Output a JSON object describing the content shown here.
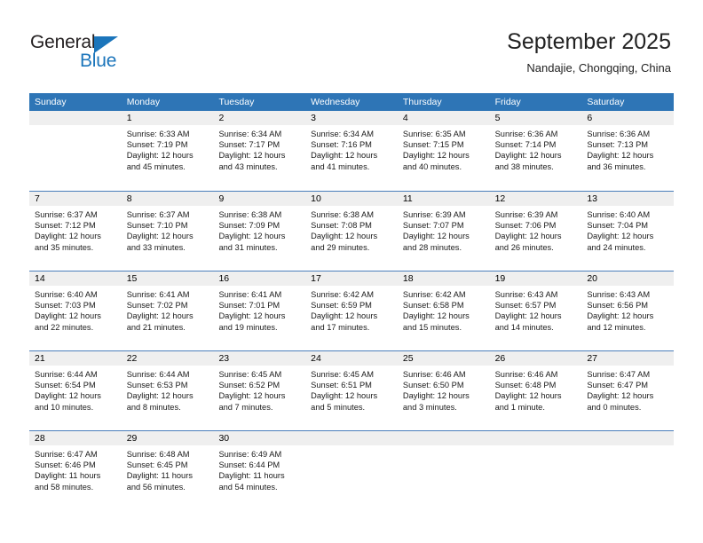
{
  "logo": {
    "word_one": "General",
    "word_two": "Blue",
    "triangle_color": "#1b75bb",
    "text_color": "#231f20"
  },
  "header": {
    "title": "September 2025",
    "subtitle": "Nandajie, Chongqing, China"
  },
  "theme": {
    "header_blue": "#2e75b6",
    "grid_line": "#4a7ebb",
    "day_band": "#efefef"
  },
  "weekdays": [
    "Sunday",
    "Monday",
    "Tuesday",
    "Wednesday",
    "Thursday",
    "Friday",
    "Saturday"
  ],
  "weeks": [
    [
      {
        "day": "",
        "sunrise": "",
        "sunset": "",
        "daylight1": "",
        "daylight2": ""
      },
      {
        "day": "1",
        "sunrise": "Sunrise: 6:33 AM",
        "sunset": "Sunset: 7:19 PM",
        "daylight1": "Daylight: 12 hours",
        "daylight2": "and 45 minutes."
      },
      {
        "day": "2",
        "sunrise": "Sunrise: 6:34 AM",
        "sunset": "Sunset: 7:17 PM",
        "daylight1": "Daylight: 12 hours",
        "daylight2": "and 43 minutes."
      },
      {
        "day": "3",
        "sunrise": "Sunrise: 6:34 AM",
        "sunset": "Sunset: 7:16 PM",
        "daylight1": "Daylight: 12 hours",
        "daylight2": "and 41 minutes."
      },
      {
        "day": "4",
        "sunrise": "Sunrise: 6:35 AM",
        "sunset": "Sunset: 7:15 PM",
        "daylight1": "Daylight: 12 hours",
        "daylight2": "and 40 minutes."
      },
      {
        "day": "5",
        "sunrise": "Sunrise: 6:36 AM",
        "sunset": "Sunset: 7:14 PM",
        "daylight1": "Daylight: 12 hours",
        "daylight2": "and 38 minutes."
      },
      {
        "day": "6",
        "sunrise": "Sunrise: 6:36 AM",
        "sunset": "Sunset: 7:13 PM",
        "daylight1": "Daylight: 12 hours",
        "daylight2": "and 36 minutes."
      }
    ],
    [
      {
        "day": "7",
        "sunrise": "Sunrise: 6:37 AM",
        "sunset": "Sunset: 7:12 PM",
        "daylight1": "Daylight: 12 hours",
        "daylight2": "and 35 minutes."
      },
      {
        "day": "8",
        "sunrise": "Sunrise: 6:37 AM",
        "sunset": "Sunset: 7:10 PM",
        "daylight1": "Daylight: 12 hours",
        "daylight2": "and 33 minutes."
      },
      {
        "day": "9",
        "sunrise": "Sunrise: 6:38 AM",
        "sunset": "Sunset: 7:09 PM",
        "daylight1": "Daylight: 12 hours",
        "daylight2": "and 31 minutes."
      },
      {
        "day": "10",
        "sunrise": "Sunrise: 6:38 AM",
        "sunset": "Sunset: 7:08 PM",
        "daylight1": "Daylight: 12 hours",
        "daylight2": "and 29 minutes."
      },
      {
        "day": "11",
        "sunrise": "Sunrise: 6:39 AM",
        "sunset": "Sunset: 7:07 PM",
        "daylight1": "Daylight: 12 hours",
        "daylight2": "and 28 minutes."
      },
      {
        "day": "12",
        "sunrise": "Sunrise: 6:39 AM",
        "sunset": "Sunset: 7:06 PM",
        "daylight1": "Daylight: 12 hours",
        "daylight2": "and 26 minutes."
      },
      {
        "day": "13",
        "sunrise": "Sunrise: 6:40 AM",
        "sunset": "Sunset: 7:04 PM",
        "daylight1": "Daylight: 12 hours",
        "daylight2": "and 24 minutes."
      }
    ],
    [
      {
        "day": "14",
        "sunrise": "Sunrise: 6:40 AM",
        "sunset": "Sunset: 7:03 PM",
        "daylight1": "Daylight: 12 hours",
        "daylight2": "and 22 minutes."
      },
      {
        "day": "15",
        "sunrise": "Sunrise: 6:41 AM",
        "sunset": "Sunset: 7:02 PM",
        "daylight1": "Daylight: 12 hours",
        "daylight2": "and 21 minutes."
      },
      {
        "day": "16",
        "sunrise": "Sunrise: 6:41 AM",
        "sunset": "Sunset: 7:01 PM",
        "daylight1": "Daylight: 12 hours",
        "daylight2": "and 19 minutes."
      },
      {
        "day": "17",
        "sunrise": "Sunrise: 6:42 AM",
        "sunset": "Sunset: 6:59 PM",
        "daylight1": "Daylight: 12 hours",
        "daylight2": "and 17 minutes."
      },
      {
        "day": "18",
        "sunrise": "Sunrise: 6:42 AM",
        "sunset": "Sunset: 6:58 PM",
        "daylight1": "Daylight: 12 hours",
        "daylight2": "and 15 minutes."
      },
      {
        "day": "19",
        "sunrise": "Sunrise: 6:43 AM",
        "sunset": "Sunset: 6:57 PM",
        "daylight1": "Daylight: 12 hours",
        "daylight2": "and 14 minutes."
      },
      {
        "day": "20",
        "sunrise": "Sunrise: 6:43 AM",
        "sunset": "Sunset: 6:56 PM",
        "daylight1": "Daylight: 12 hours",
        "daylight2": "and 12 minutes."
      }
    ],
    [
      {
        "day": "21",
        "sunrise": "Sunrise: 6:44 AM",
        "sunset": "Sunset: 6:54 PM",
        "daylight1": "Daylight: 12 hours",
        "daylight2": "and 10 minutes."
      },
      {
        "day": "22",
        "sunrise": "Sunrise: 6:44 AM",
        "sunset": "Sunset: 6:53 PM",
        "daylight1": "Daylight: 12 hours",
        "daylight2": "and 8 minutes."
      },
      {
        "day": "23",
        "sunrise": "Sunrise: 6:45 AM",
        "sunset": "Sunset: 6:52 PM",
        "daylight1": "Daylight: 12 hours",
        "daylight2": "and 7 minutes."
      },
      {
        "day": "24",
        "sunrise": "Sunrise: 6:45 AM",
        "sunset": "Sunset: 6:51 PM",
        "daylight1": "Daylight: 12 hours",
        "daylight2": "and 5 minutes."
      },
      {
        "day": "25",
        "sunrise": "Sunrise: 6:46 AM",
        "sunset": "Sunset: 6:50 PM",
        "daylight1": "Daylight: 12 hours",
        "daylight2": "and 3 minutes."
      },
      {
        "day": "26",
        "sunrise": "Sunrise: 6:46 AM",
        "sunset": "Sunset: 6:48 PM",
        "daylight1": "Daylight: 12 hours",
        "daylight2": "and 1 minute."
      },
      {
        "day": "27",
        "sunrise": "Sunrise: 6:47 AM",
        "sunset": "Sunset: 6:47 PM",
        "daylight1": "Daylight: 12 hours",
        "daylight2": "and 0 minutes."
      }
    ],
    [
      {
        "day": "28",
        "sunrise": "Sunrise: 6:47 AM",
        "sunset": "Sunset: 6:46 PM",
        "daylight1": "Daylight: 11 hours",
        "daylight2": "and 58 minutes."
      },
      {
        "day": "29",
        "sunrise": "Sunrise: 6:48 AM",
        "sunset": "Sunset: 6:45 PM",
        "daylight1": "Daylight: 11 hours",
        "daylight2": "and 56 minutes."
      },
      {
        "day": "30",
        "sunrise": "Sunrise: 6:49 AM",
        "sunset": "Sunset: 6:44 PM",
        "daylight1": "Daylight: 11 hours",
        "daylight2": "and 54 minutes."
      },
      {
        "day": "",
        "sunrise": "",
        "sunset": "",
        "daylight1": "",
        "daylight2": ""
      },
      {
        "day": "",
        "sunrise": "",
        "sunset": "",
        "daylight1": "",
        "daylight2": ""
      },
      {
        "day": "",
        "sunrise": "",
        "sunset": "",
        "daylight1": "",
        "daylight2": ""
      },
      {
        "day": "",
        "sunrise": "",
        "sunset": "",
        "daylight1": "",
        "daylight2": ""
      }
    ]
  ]
}
